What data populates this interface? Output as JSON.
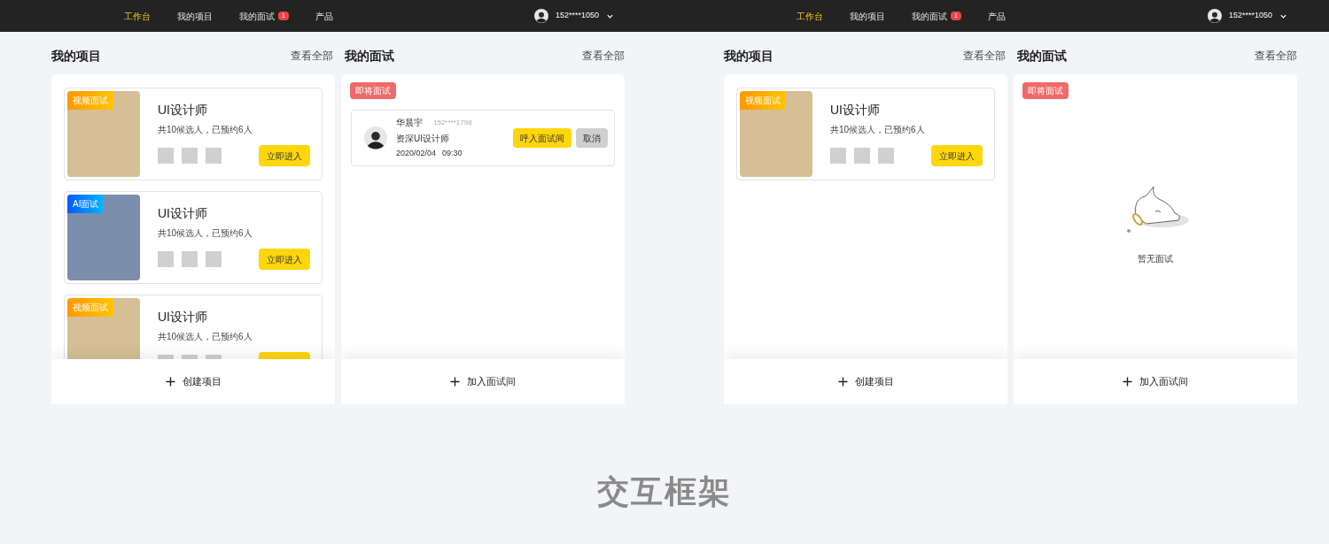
{
  "screens": [
    {
      "nav": {
        "items": [
          {
            "label": "工作台",
            "selected": true
          },
          {
            "label": "我的项目",
            "selected": false
          },
          {
            "label": "我的面试",
            "selected": false,
            "badge": "1"
          },
          {
            "label": "产品",
            "selected": false
          }
        ],
        "user": {
          "phone": "152****1050"
        }
      },
      "projects": {
        "title": "我的项目",
        "view_all": "查看全部",
        "cards": [
          {
            "kind": "video",
            "tag": "视频面试",
            "title": "UI设计师",
            "summary": "共10候选人，已预约6人",
            "button": "立即进入"
          },
          {
            "kind": "ai",
            "tag": "AI面试",
            "title": "UI设计师",
            "summary": "共10候选人，已预约6人",
            "button": "立即进入"
          },
          {
            "kind": "video",
            "tag": "视频面试",
            "title": "UI设计师",
            "summary": "共10候选人，已预约6人"
          }
        ],
        "footer": "创建项目"
      },
      "interviews": {
        "title": "我的面试",
        "view_all": "查看全部",
        "tag": "即将面试",
        "items": [
          {
            "name": "华晨宇",
            "phone": "152****1798",
            "role": "资深UI设计师",
            "date": "2020/02/04",
            "time": "09:30",
            "actions": [
              {
                "kind": "primary",
                "label": "呼入面试间"
              },
              {
                "kind": "secondary",
                "label": "取消"
              }
            ]
          }
        ],
        "footer": "加入面试间"
      }
    },
    {
      "nav": {
        "items": [
          {
            "label": "工作台",
            "selected": true
          },
          {
            "label": "我的项目",
            "selected": false
          },
          {
            "label": "我的面试",
            "selected": false,
            "badge": "1"
          },
          {
            "label": "产品",
            "selected": false
          }
        ],
        "user": {
          "phone": "152****1050"
        }
      },
      "projects": {
        "title": "我的项目",
        "view_all": "查看全部",
        "cards": [
          {
            "kind": "video",
            "tag": "视频面试",
            "title": "UI设计师",
            "summary": "共10候选人，已预约6人",
            "button": "立即进入"
          }
        ],
        "footer": "创建项目"
      },
      "interviews": {
        "title": "我的面试",
        "view_all": "查看全部",
        "tag": "即将面试",
        "empty": "暂无面试",
        "footer": "加入面试间"
      }
    }
  ],
  "caption": "交互框架"
}
